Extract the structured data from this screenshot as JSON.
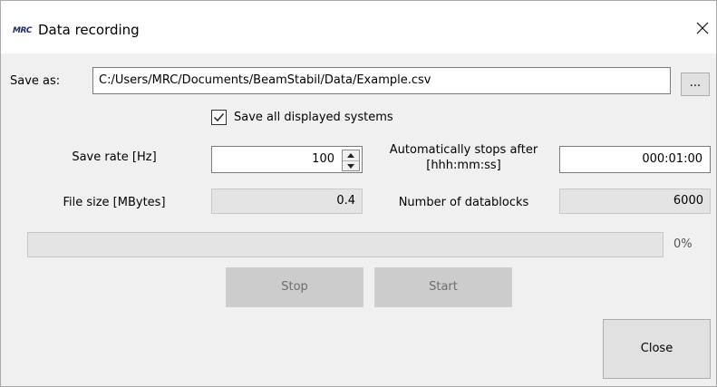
{
  "window": {
    "title": "Data recording",
    "logo_text": "MRC"
  },
  "save_as": {
    "label": "Save as:",
    "path": "C:/Users/MRC/Documents/BeamStabil/Data/Example.csv",
    "browse_label": "..."
  },
  "save_all": {
    "label": "Save all displayed systems",
    "checked": true
  },
  "save_rate": {
    "label": "Save rate [Hz]",
    "value": "100"
  },
  "auto_stop": {
    "label_line1": "Automatically stops after",
    "label_line2": "[hhh:mm:ss]",
    "value": "000:01:00"
  },
  "file_size": {
    "label": "File size [MBytes]",
    "value": "0.4"
  },
  "datablocks": {
    "label": "Number of datablocks",
    "value": "6000"
  },
  "progress": {
    "fraction": 0,
    "text": "0%",
    "fill_color": "#06b025"
  },
  "buttons": {
    "stop": "Stop",
    "start": "Start",
    "close": "Close"
  }
}
